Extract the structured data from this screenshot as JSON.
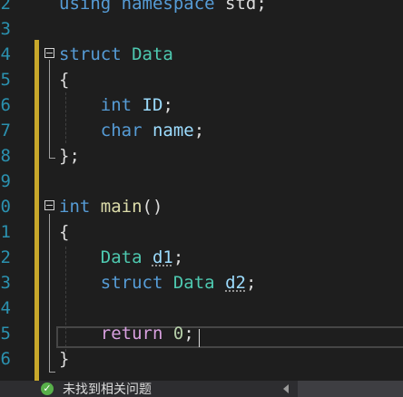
{
  "editor": {
    "lines": [
      {
        "num": "2",
        "tokens": [
          {
            "t": "using",
            "c": "kw"
          },
          {
            "t": " "
          },
          {
            "t": "namespace",
            "c": "kw"
          },
          {
            "t": " std;"
          }
        ]
      },
      {
        "num": "3",
        "tokens": []
      },
      {
        "num": "4",
        "tokens": [
          {
            "t": "struct",
            "c": "kw"
          },
          {
            "t": " "
          },
          {
            "t": "Data",
            "c": "ty"
          }
        ]
      },
      {
        "num": "5",
        "tokens": [
          {
            "t": "{"
          }
        ]
      },
      {
        "num": "6",
        "tokens": [
          {
            "t": "    "
          },
          {
            "t": "int",
            "c": "kw"
          },
          {
            "t": " "
          },
          {
            "t": "ID",
            "c": "vr"
          },
          {
            "t": ";"
          }
        ]
      },
      {
        "num": "7",
        "tokens": [
          {
            "t": "    "
          },
          {
            "t": "char",
            "c": "kw"
          },
          {
            "t": " "
          },
          {
            "t": "name",
            "c": "vr"
          },
          {
            "t": ";"
          }
        ]
      },
      {
        "num": "8",
        "tokens": [
          {
            "t": "};"
          }
        ]
      },
      {
        "num": "9",
        "tokens": []
      },
      {
        "num": "0",
        "tokens": [
          {
            "t": "int",
            "c": "kw"
          },
          {
            "t": " "
          },
          {
            "t": "main",
            "c": "fn"
          },
          {
            "t": "()"
          }
        ]
      },
      {
        "num": "1",
        "tokens": [
          {
            "t": "{"
          }
        ]
      },
      {
        "num": "2",
        "tokens": [
          {
            "t": "    "
          },
          {
            "t": "Data",
            "c": "ty"
          },
          {
            "t": " "
          },
          {
            "t": "d1",
            "c": "vr squig"
          },
          {
            "t": ";"
          }
        ]
      },
      {
        "num": "3",
        "tokens": [
          {
            "t": "    "
          },
          {
            "t": "struct",
            "c": "kw"
          },
          {
            "t": " "
          },
          {
            "t": "Data",
            "c": "ty"
          },
          {
            "t": " "
          },
          {
            "t": "d2",
            "c": "vr squig"
          },
          {
            "t": ";"
          }
        ]
      },
      {
        "num": "4",
        "tokens": []
      },
      {
        "num": "5",
        "tokens": [
          {
            "t": "    "
          },
          {
            "t": "return",
            "c": "ctl"
          },
          {
            "t": " "
          },
          {
            "t": "0",
            "c": "num"
          },
          {
            "t": ";"
          }
        ]
      },
      {
        "num": "6",
        "tokens": [
          {
            "t": "}"
          }
        ]
      }
    ]
  },
  "status": {
    "icon": "check-circle-icon",
    "message": "未找到相关问题"
  }
}
